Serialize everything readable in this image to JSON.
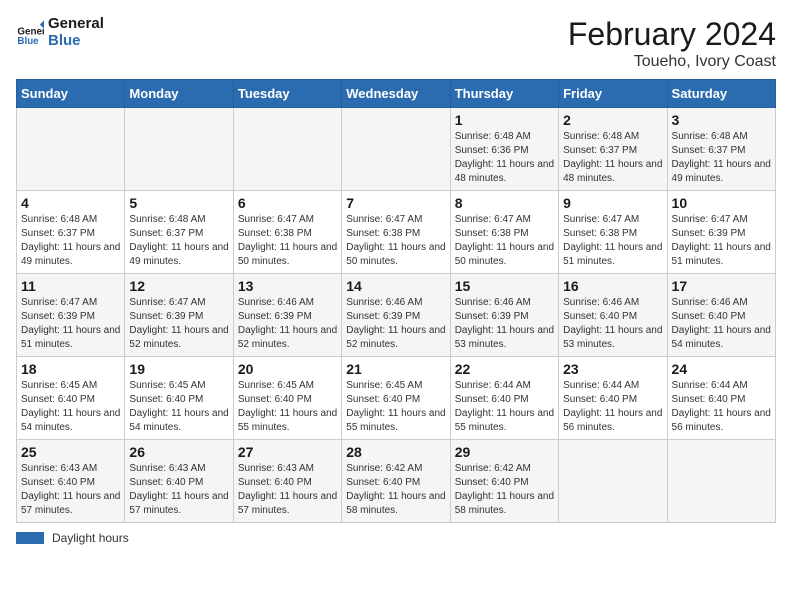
{
  "logo": {
    "text_general": "General",
    "text_blue": "Blue"
  },
  "title": "February 2024",
  "subtitle": "Toueho, Ivory Coast",
  "footer_legend": "Daylight hours",
  "days_of_week": [
    "Sunday",
    "Monday",
    "Tuesday",
    "Wednesday",
    "Thursday",
    "Friday",
    "Saturday"
  ],
  "weeks": [
    [
      {
        "num": "",
        "info": ""
      },
      {
        "num": "",
        "info": ""
      },
      {
        "num": "",
        "info": ""
      },
      {
        "num": "",
        "info": ""
      },
      {
        "num": "1",
        "info": "Sunrise: 6:48 AM\nSunset: 6:36 PM\nDaylight: 11 hours and 48 minutes."
      },
      {
        "num": "2",
        "info": "Sunrise: 6:48 AM\nSunset: 6:37 PM\nDaylight: 11 hours and 48 minutes."
      },
      {
        "num": "3",
        "info": "Sunrise: 6:48 AM\nSunset: 6:37 PM\nDaylight: 11 hours and 49 minutes."
      }
    ],
    [
      {
        "num": "4",
        "info": "Sunrise: 6:48 AM\nSunset: 6:37 PM\nDaylight: 11 hours and 49 minutes."
      },
      {
        "num": "5",
        "info": "Sunrise: 6:48 AM\nSunset: 6:37 PM\nDaylight: 11 hours and 49 minutes."
      },
      {
        "num": "6",
        "info": "Sunrise: 6:47 AM\nSunset: 6:38 PM\nDaylight: 11 hours and 50 minutes."
      },
      {
        "num": "7",
        "info": "Sunrise: 6:47 AM\nSunset: 6:38 PM\nDaylight: 11 hours and 50 minutes."
      },
      {
        "num": "8",
        "info": "Sunrise: 6:47 AM\nSunset: 6:38 PM\nDaylight: 11 hours and 50 minutes."
      },
      {
        "num": "9",
        "info": "Sunrise: 6:47 AM\nSunset: 6:38 PM\nDaylight: 11 hours and 51 minutes."
      },
      {
        "num": "10",
        "info": "Sunrise: 6:47 AM\nSunset: 6:39 PM\nDaylight: 11 hours and 51 minutes."
      }
    ],
    [
      {
        "num": "11",
        "info": "Sunrise: 6:47 AM\nSunset: 6:39 PM\nDaylight: 11 hours and 51 minutes."
      },
      {
        "num": "12",
        "info": "Sunrise: 6:47 AM\nSunset: 6:39 PM\nDaylight: 11 hours and 52 minutes."
      },
      {
        "num": "13",
        "info": "Sunrise: 6:46 AM\nSunset: 6:39 PM\nDaylight: 11 hours and 52 minutes."
      },
      {
        "num": "14",
        "info": "Sunrise: 6:46 AM\nSunset: 6:39 PM\nDaylight: 11 hours and 52 minutes."
      },
      {
        "num": "15",
        "info": "Sunrise: 6:46 AM\nSunset: 6:39 PM\nDaylight: 11 hours and 53 minutes."
      },
      {
        "num": "16",
        "info": "Sunrise: 6:46 AM\nSunset: 6:40 PM\nDaylight: 11 hours and 53 minutes."
      },
      {
        "num": "17",
        "info": "Sunrise: 6:46 AM\nSunset: 6:40 PM\nDaylight: 11 hours and 54 minutes."
      }
    ],
    [
      {
        "num": "18",
        "info": "Sunrise: 6:45 AM\nSunset: 6:40 PM\nDaylight: 11 hours and 54 minutes."
      },
      {
        "num": "19",
        "info": "Sunrise: 6:45 AM\nSunset: 6:40 PM\nDaylight: 11 hours and 54 minutes."
      },
      {
        "num": "20",
        "info": "Sunrise: 6:45 AM\nSunset: 6:40 PM\nDaylight: 11 hours and 55 minutes."
      },
      {
        "num": "21",
        "info": "Sunrise: 6:45 AM\nSunset: 6:40 PM\nDaylight: 11 hours and 55 minutes."
      },
      {
        "num": "22",
        "info": "Sunrise: 6:44 AM\nSunset: 6:40 PM\nDaylight: 11 hours and 55 minutes."
      },
      {
        "num": "23",
        "info": "Sunrise: 6:44 AM\nSunset: 6:40 PM\nDaylight: 11 hours and 56 minutes."
      },
      {
        "num": "24",
        "info": "Sunrise: 6:44 AM\nSunset: 6:40 PM\nDaylight: 11 hours and 56 minutes."
      }
    ],
    [
      {
        "num": "25",
        "info": "Sunrise: 6:43 AM\nSunset: 6:40 PM\nDaylight: 11 hours and 57 minutes."
      },
      {
        "num": "26",
        "info": "Sunrise: 6:43 AM\nSunset: 6:40 PM\nDaylight: 11 hours and 57 minutes."
      },
      {
        "num": "27",
        "info": "Sunrise: 6:43 AM\nSunset: 6:40 PM\nDaylight: 11 hours and 57 minutes."
      },
      {
        "num": "28",
        "info": "Sunrise: 6:42 AM\nSunset: 6:40 PM\nDaylight: 11 hours and 58 minutes."
      },
      {
        "num": "29",
        "info": "Sunrise: 6:42 AM\nSunset: 6:40 PM\nDaylight: 11 hours and 58 minutes."
      },
      {
        "num": "",
        "info": ""
      },
      {
        "num": "",
        "info": ""
      }
    ]
  ]
}
